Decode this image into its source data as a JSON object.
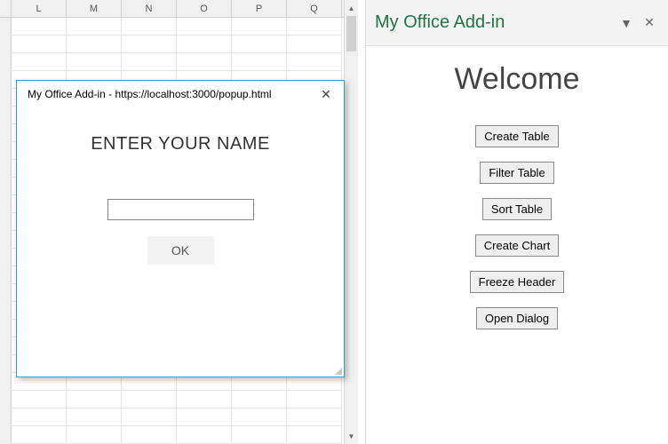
{
  "sheet": {
    "columns": [
      "L",
      "M",
      "N",
      "O",
      "P",
      "Q"
    ]
  },
  "popup": {
    "title": "My Office Add-in - https://localhost:3000/popup.html",
    "heading": "ENTER YOUR NAME",
    "input_value": "",
    "ok_label": "OK"
  },
  "pane": {
    "title": "My Office Add-in",
    "welcome": "Welcome",
    "buttons": [
      "Create Table",
      "Filter Table",
      "Sort Table",
      "Create Chart",
      "Freeze Header",
      "Open Dialog"
    ]
  }
}
